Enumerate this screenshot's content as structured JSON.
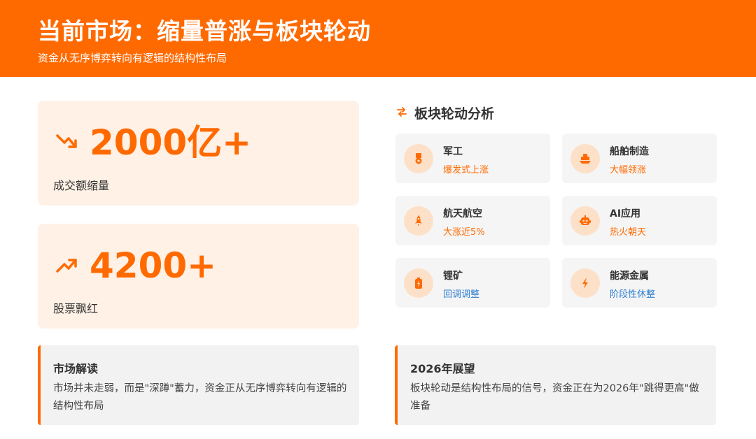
{
  "header": {
    "title": "当前市场：缩量普涨与板块轮动",
    "subtitle": "资金从无序博弈转向有逻辑的结构性布局",
    "background": "#ff6a00"
  },
  "stats": [
    {
      "icon": "trend-down-icon",
      "value": "2000亿+",
      "label": "成交额缩量"
    },
    {
      "icon": "trend-up-icon",
      "value": "4200+",
      "label": "股票飘红"
    }
  ],
  "rotation": {
    "icon": "swap-arrows-icon",
    "title": "板块轮动分析",
    "sectors": [
      {
        "icon": "medal-icon",
        "name": "军工",
        "status": "爆发式上涨",
        "status_color": "#ff6a00"
      },
      {
        "icon": "ship-icon",
        "name": "船舶制造",
        "status": "大幅领涨",
        "status_color": "#ff6a00"
      },
      {
        "icon": "rocket-icon",
        "name": "航天航空",
        "status": "大涨近5%",
        "status_color": "#ff6a00"
      },
      {
        "icon": "robot-icon",
        "name": "AI应用",
        "status": "热火朝天",
        "status_color": "#ff6a00"
      },
      {
        "icon": "battery-icon",
        "name": "锂矿",
        "status": "回调调整",
        "status_color": "#2f7fd1"
      },
      {
        "icon": "bolt-icon",
        "name": "能源金属",
        "status": "阶段性休整",
        "status_color": "#2f7fd1"
      }
    ]
  },
  "notes": [
    {
      "title": "市场解读",
      "text": "市场并未走弱，而是\"深蹲\"蓄力，资金正从无序博弈转向有逻辑的结构性布局"
    },
    {
      "title": "2026年展望",
      "text": "板块轮动是结构性布局的信号，资金正在为2026年\"跳得更高\"做准备"
    }
  ],
  "colors": {
    "accent": "#ff6a00",
    "rise": "#ff6a00",
    "fall": "#2f7fd1"
  }
}
